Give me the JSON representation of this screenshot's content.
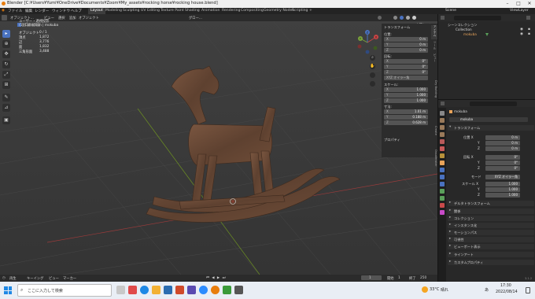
{
  "window": {
    "title": "Blender [C:¥Users¥Yumi¥OneDrive¥Documents¥Zoom¥My_assets¥rocking horse¥rocking house.blend]"
  },
  "menubar": {
    "items": [
      "ファイル",
      "編集",
      "レンダー",
      "ウィンドウ",
      "ヘルプ"
    ],
    "workspace_tabs": [
      "Layout",
      "Modeling",
      "Sculpting",
      "UV Editing",
      "Texture Paint",
      "Shading",
      "Animation",
      "Rendering",
      "Compositing",
      "Geometry Nodes",
      "Scripting"
    ],
    "active_tab": "Layout",
    "add_tab": "+",
    "scene": "Scene",
    "view_layer": "ViewLayer"
  },
  "viewport_header": {
    "mode": "オブジェクト...",
    "menus": [
      "ビュー",
      "選択",
      "追加",
      "オブジェクト"
    ],
    "orientation": "グロー...",
    "options": "オプション"
  },
  "viewport_overlay": {
    "title": "ユーザー・透視投影",
    "collection": "(1) Collection | mokuba",
    "stats": [
      {
        "label": "オブジェクト",
        "value": "0 / 1"
      },
      {
        "label": "頂点",
        "value": "1,872"
      },
      {
        "label": "辺",
        "value": "3,776"
      },
      {
        "label": "面",
        "value": "1,832"
      },
      {
        "label": "三角形面",
        "value": "3,488"
      }
    ]
  },
  "npanel": {
    "header": "トランスフォーム",
    "location_label": "位置:",
    "location": [
      {
        "axis": "X",
        "value": "0 m"
      },
      {
        "axis": "Y",
        "value": "0 m"
      },
      {
        "axis": "Z",
        "value": "0 m"
      }
    ],
    "rotation_label": "回転:",
    "rotation": [
      {
        "axis": "X",
        "value": "0°"
      },
      {
        "axis": "Y",
        "value": "0°"
      },
      {
        "axis": "Z",
        "value": "0°"
      }
    ],
    "rotation_mode": "XYZ オイラー角",
    "scale_label": "スケール:",
    "scale": [
      {
        "axis": "X",
        "value": "1.000"
      },
      {
        "axis": "Y",
        "value": "1.000"
      },
      {
        "axis": "Z",
        "value": "1.000"
      }
    ],
    "dimensions_label": "寸法:",
    "dimensions": [
      {
        "axis": "X",
        "value": "1.01 m"
      },
      {
        "axis": "Y",
        "value": "0.188 m"
      },
      {
        "axis": "Z",
        "value": "0.628 m"
      }
    ],
    "properties_section": "プロパティ",
    "side_tabs": [
      "アイテム",
      "ツール",
      "ビュー",
      "Dry Building",
      "Create",
      "Ossafenster"
    ]
  },
  "gizmo": {
    "x": "X",
    "y": "Y",
    "z": "Z"
  },
  "bottom_bar": {
    "menus": [
      "再生",
      "キーイング",
      "ビュー",
      "マーカー"
    ],
    "current_frame": "1",
    "start_label": "開始",
    "start": "1",
    "end_label": "終了",
    "end": "250"
  },
  "outliner": {
    "root": "シーンコレクション",
    "collection": "Collection",
    "object": "mokuba"
  },
  "properties": {
    "object_name": "mokuba",
    "object_sub": "mokuba",
    "transform_header": "トランスフォーム",
    "location_label": "位置 X",
    "location": [
      {
        "axis": "X",
        "value": "0 m"
      },
      {
        "axis": "Y",
        "value": "0 m"
      },
      {
        "axis": "Z",
        "value": "0 m"
      }
    ],
    "rotation_label": "回転 X",
    "rotation": [
      {
        "axis": "X",
        "value": "0°"
      },
      {
        "axis": "Y",
        "value": "0°"
      },
      {
        "axis": "Z",
        "value": "0°"
      }
    ],
    "mode_label": "モード",
    "mode": "XYZ オイラー角",
    "scale_label": "スケール X",
    "scale": [
      {
        "axis": "X",
        "value": "1.000"
      },
      {
        "axis": "Y",
        "value": "1.000"
      },
      {
        "axis": "Z",
        "value": "1.000"
      }
    ],
    "sections": [
      "デルタトランスフォーム",
      "関係",
      "コレクション",
      "インスタンス化",
      "モーションパス",
      "可視性",
      "ビューポート表示",
      "ラインアート",
      "カスタムプロパティ"
    ],
    "version": "3.1.2"
  },
  "taskbar": {
    "search_placeholder": "ここに入力して検索",
    "weather": "33°C",
    "weather_desc": "晴れ",
    "ime": "あ",
    "time": "17:30",
    "date": "2022/08/14"
  },
  "colors": {
    "accent": "#4a72c0",
    "viewport_bg": "#3c3c3c",
    "wood": "#6b4a35"
  }
}
